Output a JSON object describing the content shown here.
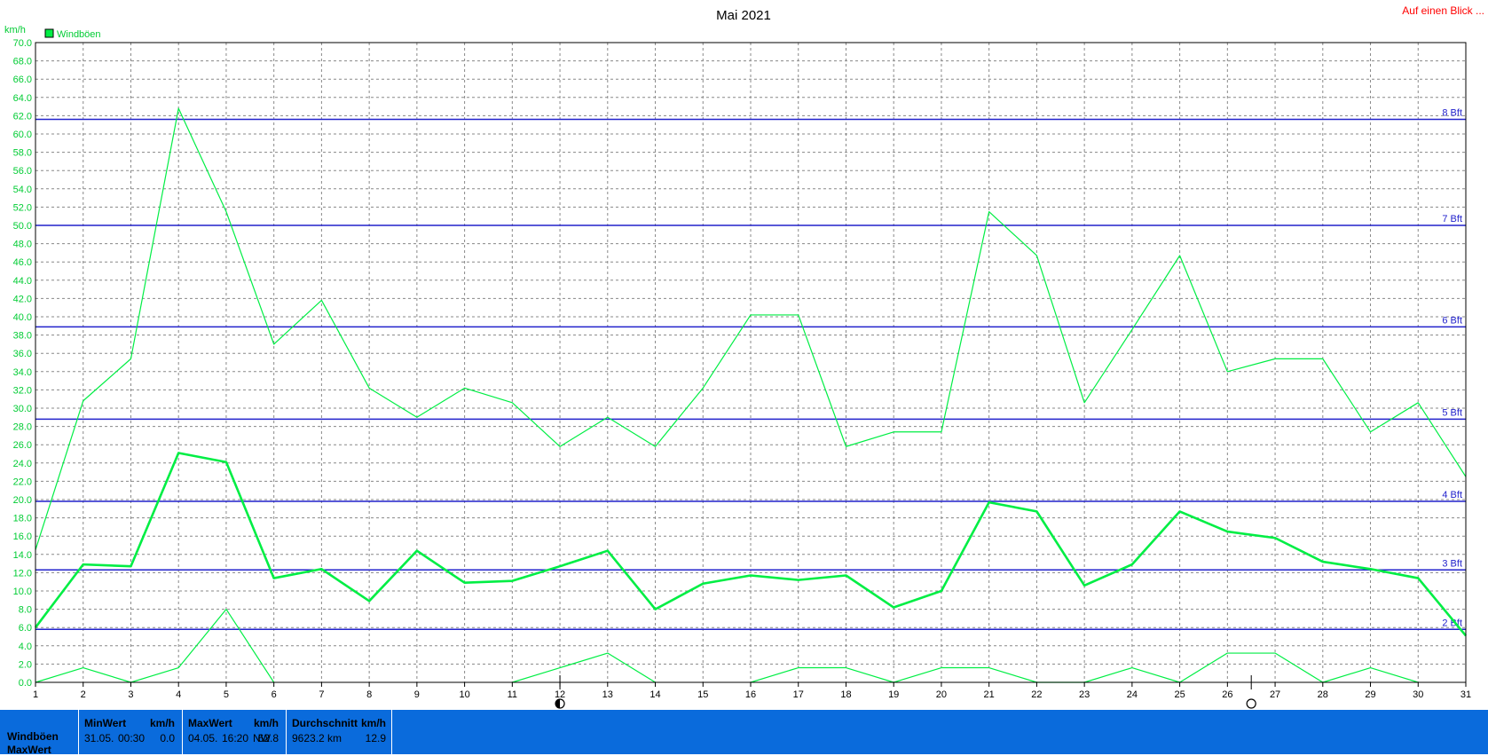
{
  "header": {
    "title": "Mai 2021",
    "link_label": "Auf einen Blick ...",
    "unit_label": "km/h",
    "legend_label": "Windböen"
  },
  "colors": {
    "series": "#00ee44",
    "grid": "#888888",
    "bft": "#2222cc",
    "link": "#ff0000",
    "bar": "#0a6bdc"
  },
  "chart_data": {
    "type": "line",
    "title": "Mai 2021",
    "ylabel": "km/h",
    "x": [
      1,
      2,
      3,
      4,
      5,
      6,
      7,
      8,
      9,
      10,
      11,
      12,
      13,
      14,
      15,
      16,
      17,
      18,
      19,
      20,
      21,
      22,
      23,
      24,
      25,
      26,
      27,
      28,
      29,
      30,
      31
    ],
    "xlim": [
      1,
      31
    ],
    "ylim": [
      0,
      70
    ],
    "ytick_step": 2,
    "legend": "top-left",
    "grid": true,
    "series": [
      {
        "name": "Windböen",
        "role": "max",
        "values": [
          14.5,
          30.8,
          35.4,
          62.8,
          51.5,
          37.0,
          41.8,
          32.2,
          29.0,
          32.2,
          30.6,
          25.8,
          29.0,
          25.8,
          32.2,
          40.2,
          40.2,
          25.8,
          27.4,
          27.4,
          51.5,
          46.7,
          30.6,
          38.6,
          46.7,
          34.0,
          35.4,
          35.4,
          27.4,
          30.6,
          22.5
        ]
      },
      {
        "role": "average",
        "values": [
          6.0,
          12.9,
          12.7,
          25.1,
          24.1,
          11.4,
          12.4,
          8.9,
          14.4,
          10.9,
          11.1,
          12.7,
          14.4,
          8.0,
          10.8,
          11.7,
          11.2,
          11.7,
          8.2,
          10.0,
          19.7,
          18.7,
          10.6,
          12.9,
          18.7,
          16.5,
          15.8,
          13.2,
          12.4,
          11.4,
          5.1
        ]
      },
      {
        "role": "min",
        "values": [
          0.0,
          1.6,
          0.0,
          1.6,
          8.0,
          0.0,
          null,
          null,
          null,
          null,
          0.0,
          1.6,
          3.2,
          0.0,
          null,
          0.0,
          1.6,
          1.6,
          0.0,
          1.6,
          1.6,
          0.0,
          0.0,
          1.6,
          0.0,
          3.2,
          3.2,
          0.0,
          1.6,
          0.0,
          null
        ]
      }
    ],
    "beaufort": [
      {
        "label": "2 Bft",
        "value": 5.8
      },
      {
        "label": "3 Bft",
        "value": 12.3
      },
      {
        "label": "4 Bft",
        "value": 19.8
      },
      {
        "label": "5 Bft",
        "value": 28.8
      },
      {
        "label": "6 Bft",
        "value": 38.9
      },
      {
        "label": "7 Bft",
        "value": 50.0
      },
      {
        "label": "8 Bft",
        "value": 61.6
      }
    ],
    "moon_markers": [
      {
        "day": 12,
        "icon": "half-moon-icon"
      },
      {
        "day": 26.5,
        "icon": "full-moon-icon"
      }
    ]
  },
  "summary": {
    "row_labels": [
      "Windböen",
      "MaxWert"
    ],
    "min": {
      "header": "MinWert",
      "unit": "km/h",
      "date": "31.05.",
      "time": "00:30",
      "value": "0.0"
    },
    "max": {
      "header": "MaxWert",
      "unit": "km/h",
      "date": "04.05.",
      "time": "16:20",
      "dir": "NW",
      "value": "62.8"
    },
    "avg": {
      "header": "Durchschnitt",
      "unit": "km/h",
      "distance": "9623.2 km",
      "value": "12.9"
    }
  }
}
